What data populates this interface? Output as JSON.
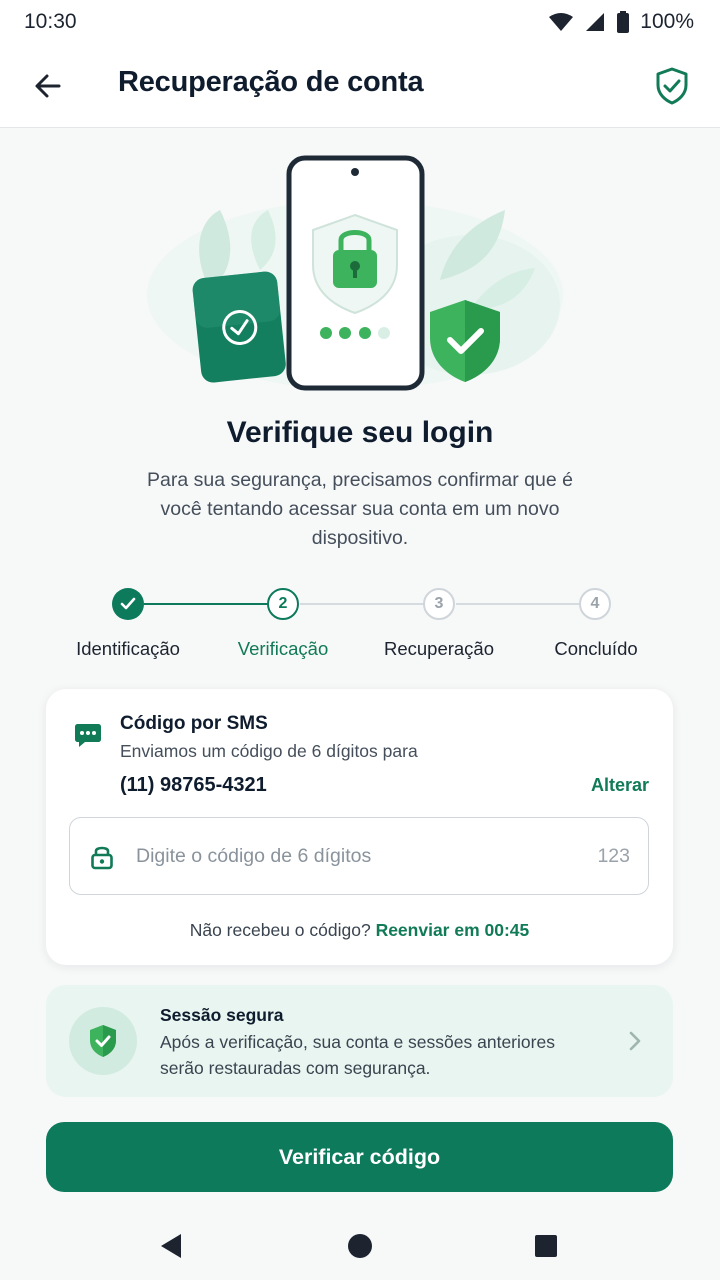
{
  "status_bar": {
    "time": "10:30",
    "battery": "100%"
  },
  "app_bar": {
    "title": "Recuperação de conta"
  },
  "main": {
    "heading": "Verifique seu login",
    "subtitle": "Para sua segurança, precisamos confirmar que é você tentando acessar sua conta em um novo dispositivo."
  },
  "stepper": {
    "active_step": 2,
    "steps": [
      {
        "number": "1",
        "label": "Identificação",
        "state": "completed"
      },
      {
        "number": "2",
        "label": "Verificação",
        "state": "active"
      },
      {
        "number": "3",
        "label": "Recuperação",
        "state": "pending"
      },
      {
        "number": "4",
        "label": "Concluído",
        "state": "pending"
      }
    ]
  },
  "sms_card": {
    "title": "Código por SMS",
    "description": "Enviamos um código de 6 dígitos para",
    "phone": "(11) 98765-4321",
    "change_label": "Alterar",
    "code_input": {
      "value": "",
      "placeholder": "Digite o código de 6 dígitos",
      "hint": "123"
    },
    "resend_prefix": "Não recebeu o código?",
    "resend_link": "Reenviar em 00:45"
  },
  "secure_card": {
    "title": "Sessão segura",
    "description": "Após a verificação, sua conta e sessões anteriores serão restauradas com segurança."
  },
  "primary_button": {
    "label": "Verificar código"
  },
  "colors": {
    "brand": "#0d7a5c",
    "accent_text": "#117a57",
    "success_green": "#3db35e",
    "background": "#f7f8f8",
    "card_secure_bg": "#e9f5f0"
  },
  "icons": [
    "back-arrow-icon",
    "shield-check-icon",
    "sms-chat-icon",
    "lock-icon",
    "chevron-right-icon",
    "wifi-icon",
    "signal-icon",
    "battery-icon",
    "nav-back-icon",
    "nav-home-icon",
    "nav-recents-icon"
  ]
}
